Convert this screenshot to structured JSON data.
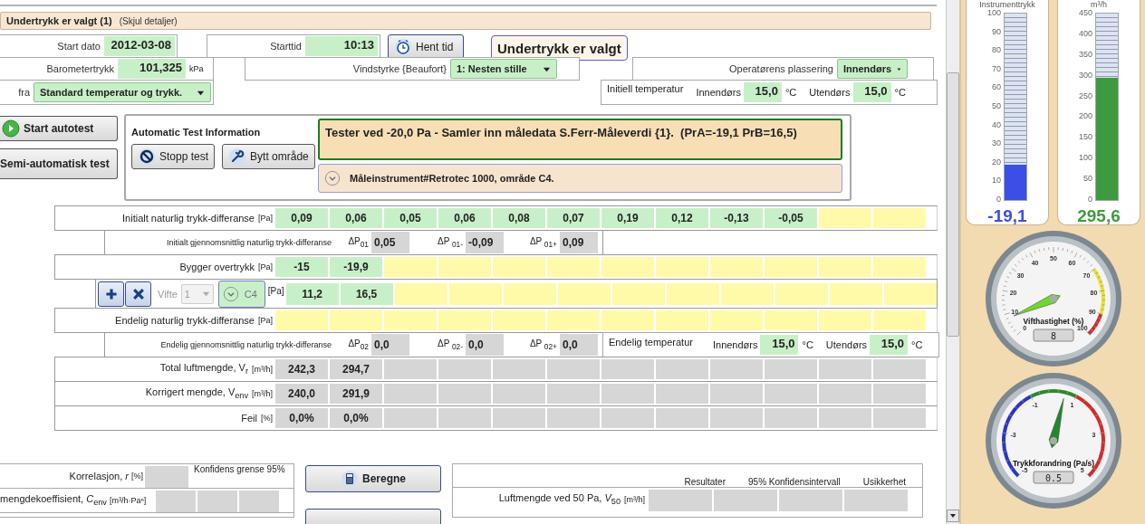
{
  "header": {
    "title": "Undertrykk er valgt (1)",
    "link": "(Skjul detaljer)"
  },
  "start_date": {
    "label": "Start dato",
    "value": "2012-03-08"
  },
  "start_time": {
    "label": "Starttid",
    "value": "10:13"
  },
  "get_time_button": "Hent tid",
  "mode_label": "Undertrykk er valgt",
  "barometer": {
    "label": "Barometertrykk",
    "value": "101,325",
    "unit": "kPa"
  },
  "wind": {
    "label": "Vindstyrke {Beaufort}",
    "value": "1: Nesten stille"
  },
  "operator": {
    "label": "Operatørens plassering",
    "value": "Innendørs"
  },
  "source": {
    "label": "fra",
    "value": "Standard temperatur og trykk."
  },
  "initial_temperature": {
    "label": "Initiell temperatur",
    "indoor_label": "Innendørs",
    "indoor": "15,0",
    "indoor_unit": "°C",
    "outdoor_label": "Utendørs",
    "outdoor": "15,0",
    "outdoor_unit": "°C"
  },
  "side_buttons": [
    "Start autotest",
    "Semi-automatisk test"
  ],
  "auto_test": {
    "title": "Automatic Test Information",
    "buttons": [
      "Stopp test",
      "Bytt område"
    ],
    "status": "Tester ved -20,0 Pa - Samler inn måledata S.Ferr-Måleverdi {1}.  (PrA=-19,1 PrB=16,5)",
    "instrument": {
      "label": "Måleinstrument#Retrotec 1000, område C4.",
      "expanded": false
    }
  },
  "table": {
    "rows": [
      {
        "kind": "values",
        "label": "Initialt naturlig trykk-differanse",
        "unit": "[Pa]",
        "cells": [
          {
            "value": "0,09",
            "kind": "measured"
          },
          {
            "value": "0,06",
            "kind": "measured"
          },
          {
            "value": "0,05",
            "kind": "measured"
          },
          {
            "value": "0,06",
            "kind": "measured"
          },
          {
            "value": "0,08",
            "kind": "measured"
          },
          {
            "value": "0,07",
            "kind": "measured"
          },
          {
            "value": "0,19",
            "kind": "measured"
          },
          {
            "value": "0,12",
            "kind": "measured"
          },
          {
            "value": "-0,13",
            "kind": "measured"
          },
          {
            "value": "-0,05",
            "kind": "measured"
          },
          {
            "kind": "pending"
          },
          {
            "kind": "pending"
          }
        ]
      },
      {
        "kind": "average",
        "label": "Initialt gjennomsnittlig naturlig trykk-differanse",
        "items": [
          {
            "symbol": "ΔP$_{01}$",
            "value": "0,05"
          },
          {
            "symbol": "ΔP $_{01-}$",
            "value": "-0,09"
          },
          {
            "symbol": "ΔP $_{01+}$",
            "value": "0,09"
          }
        ]
      },
      {
        "kind": "values",
        "label": "Bygger overtrykk",
        "unit": "[Pa]",
        "cells": [
          {
            "value": "-15",
            "kind": "measured"
          },
          {
            "value": "-19,9",
            "kind": "measured"
          },
          {
            "kind": "pending"
          },
          {
            "kind": "pending"
          },
          {
            "kind": "pending"
          },
          {
            "kind": "pending"
          },
          {
            "kind": "pending"
          },
          {
            "kind": "pending"
          },
          {
            "kind": "pending"
          },
          {
            "kind": "pending"
          },
          {
            "kind": "pending"
          },
          {
            "kind": "pending"
          }
        ]
      },
      {
        "kind": "fan",
        "fan_label": "Vifte",
        "fan_value": "1",
        "fan_disabled": true,
        "range": "C4",
        "range_expanded": false,
        "unit": "[Pa]",
        "cells": [
          {
            "value": "11,2",
            "kind": "measured"
          },
          {
            "value": "16,5",
            "kind": "measured"
          },
          {
            "kind": "pending"
          },
          {
            "kind": "pending"
          },
          {
            "kind": "pending"
          },
          {
            "kind": "pending"
          },
          {
            "kind": "pending"
          },
          {
            "kind": "pending"
          },
          {
            "kind": "pending"
          },
          {
            "kind": "pending"
          },
          {
            "kind": "pending"
          },
          {
            "kind": "pending"
          }
        ]
      },
      {
        "kind": "values",
        "label": "Endelig naturlig trykk-differanse",
        "unit": "[Pa]",
        "cells": [
          {
            "kind": "pending"
          },
          {
            "kind": "pending"
          },
          {
            "kind": "pending"
          },
          {
            "kind": "pending"
          },
          {
            "kind": "pending"
          },
          {
            "kind": "pending"
          },
          {
            "kind": "pending"
          },
          {
            "kind": "pending"
          },
          {
            "kind": "pending"
          },
          {
            "kind": "pending"
          },
          {
            "kind": "pending"
          },
          {
            "kind": "pending"
          }
        ]
      },
      {
        "kind": "average",
        "label": "Endelig gjennomsnittlig naturlig trykk-differanse",
        "items": [
          {
            "symbol": "ΔP$_{02}$",
            "value": "0,0"
          },
          {
            "symbol": "ΔP $_{02-}$",
            "value": "0,0"
          },
          {
            "symbol": "ΔP $_{02+}$",
            "value": "0,0"
          }
        ],
        "temperature": {
          "label": "Endelig temperatur",
          "indoor_label": "Innendørs",
          "indoor": "15,0",
          "indoor_unit": "°C",
          "outdoor_label": "Utendørs",
          "outdoor": "15,0",
          "outdoor_unit": "°C"
        }
      },
      {
        "kind": "values",
        "label": "Total luftmengde, V$_{r}$",
        "unit": "[m³/h]",
        "cells": [
          {
            "value": "242,3",
            "kind": "calculated"
          },
          {
            "value": "294,7",
            "kind": "calculated"
          },
          {
            "kind": "calculated"
          },
          {
            "kind": "calculated"
          },
          {
            "kind": "calculated"
          },
          {
            "kind": "calculated"
          },
          {
            "kind": "calculated"
          },
          {
            "kind": "calculated"
          },
          {
            "kind": "calculated"
          },
          {
            "kind": "calculated"
          },
          {
            "kind": "calculated"
          },
          {
            "kind": "calculated"
          }
        ]
      },
      {
        "kind": "values",
        "label": "Korrigert mengde, V$_{env}$",
        "unit": "[m³/h]",
        "cells": [
          {
            "value": "240,0",
            "kind": "calculated"
          },
          {
            "value": "291,9",
            "kind": "calculated"
          },
          {
            "kind": "calculated"
          },
          {
            "kind": "calculated"
          },
          {
            "kind": "calculated"
          },
          {
            "kind": "calculated"
          },
          {
            "kind": "calculated"
          },
          {
            "kind": "calculated"
          },
          {
            "kind": "calculated"
          },
          {
            "kind": "calculated"
          },
          {
            "kind": "calculated"
          },
          {
            "kind": "calculated"
          }
        ]
      },
      {
        "kind": "values",
        "label": "Feil",
        "unit": "[%]",
        "cells": [
          {
            "value": "0,0%",
            "kind": "calculated"
          },
          {
            "value": "0,0%",
            "kind": "calculated"
          },
          {
            "kind": "calculated"
          },
          {
            "kind": "calculated"
          },
          {
            "kind": "calculated"
          },
          {
            "kind": "calculated"
          },
          {
            "kind": "calculated"
          },
          {
            "kind": "calculated"
          },
          {
            "kind": "calculated"
          },
          {
            "kind": "calculated"
          },
          {
            "kind": "calculated"
          },
          {
            "kind": "calculated"
          }
        ]
      }
    ]
  },
  "statistics": {
    "rows": [
      {
        "label": "Korrelasjon, *r*",
        "unit": "[%]",
        "cells": [
          {
            "kind": "calculated"
          }
        ],
        "note": "Konfidens grense 95%"
      },
      {
        "label": "mengdekoeffisient, *C*$_{env}$",
        "unit": "[m³/h·Paⁿ]",
        "cells": [
          {
            "kind": "calculated"
          },
          {
            "kind": "calculated"
          },
          {
            "kind": "calculated"
          }
        ]
      }
    ]
  },
  "calculate_button": "Beregne",
  "results": {
    "columns": [
      "Resultater",
      "95% Konfidensintervall",
      "Usikkerhet"
    ],
    "rows": [
      {
        "label": "Luftmengde ved 50 Pa, *V*$_{50}$",
        "unit": "[m³/h]",
        "cells": [
          {
            "kind": "calculated"
          },
          {
            "kind": "calculated"
          },
          {
            "kind": "calculated"
          },
          {
            "kind": "calculated"
          }
        ]
      }
    ]
  },
  "meters": [
    {
      "title": "Instrumenttrykk",
      "ticks": [
        "100",
        "90",
        "80",
        "70",
        "60",
        "50",
        "40",
        "30",
        "20",
        "10",
        "0"
      ],
      "level": 0.19,
      "reading": "-19,1",
      "color": "#3b4fe6"
    },
    {
      "title": "m³/h",
      "ticks": [
        "450",
        "400",
        "350",
        "300",
        "250",
        "200",
        "150",
        "100",
        "50",
        "0"
      ],
      "level": 0.657,
      "reading": "295,6",
      "color": "#3e9a3e"
    }
  ],
  "dials": [
    {
      "kind": "speed",
      "title": "Vifthastighet (%)",
      "ticks": [
        "0",
        "10",
        "20",
        "30",
        "40",
        "50",
        "60",
        "70",
        "80",
        "90",
        "100"
      ],
      "display": "8"
    },
    {
      "kind": "pressure",
      "title": "Trykkforandring (Pa/s)",
      "ticks": [
        "-5",
        "-3",
        "-1",
        "1",
        "3",
        "5"
      ],
      "display": "0.5"
    }
  ]
}
